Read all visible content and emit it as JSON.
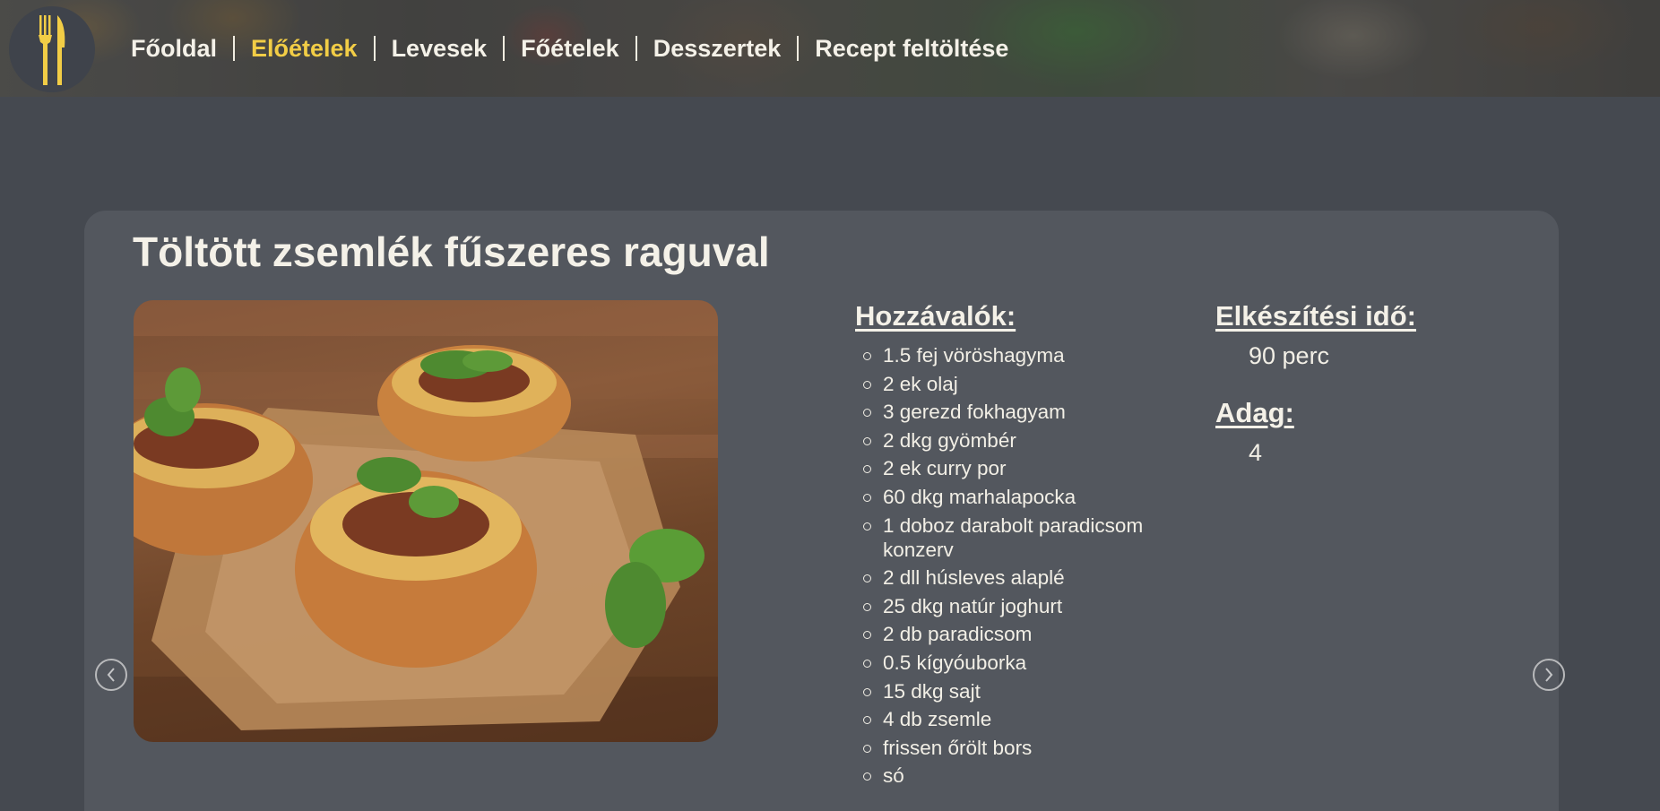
{
  "nav": {
    "items": [
      {
        "label": "Főoldal",
        "active": false
      },
      {
        "label": "Előételek",
        "active": true
      },
      {
        "label": "Levesek",
        "active": false
      },
      {
        "label": "Főételek",
        "active": false
      },
      {
        "label": "Desszertek",
        "active": false
      },
      {
        "label": "Recept feltöltése",
        "active": false
      }
    ]
  },
  "recipe": {
    "title": "Töltött zsemlék fűszeres raguval",
    "ingredients_heading": "Hozzávalók:",
    "ingredients": [
      "1.5 fej vöröshagyma",
      "2 ek olaj",
      "3 gerezd fokhagyam",
      "2 dkg gyömbér",
      "2 ek curry por",
      "60 dkg marhalapocka",
      "1 doboz darabolt paradicsom konzerv",
      "2 dll húsleves alaplé",
      "25 dkg natúr joghurt",
      "2 db paradicsom",
      "0.5 kígyóuborka",
      "15 dkg sajt",
      "4 db zsemle",
      "frissen őrölt bors",
      "só"
    ],
    "time_heading": "Elkészítési idő:",
    "time_value": "90 perc",
    "portion_heading": "Adag:",
    "portion_value": "4"
  },
  "icons": {
    "logo": "fork-knife-icon",
    "prev": "chevron-left-icon",
    "next": "chevron-right-icon"
  },
  "colors": {
    "accent": "#f2cd46",
    "background": "#454950",
    "card": "#53575e"
  }
}
